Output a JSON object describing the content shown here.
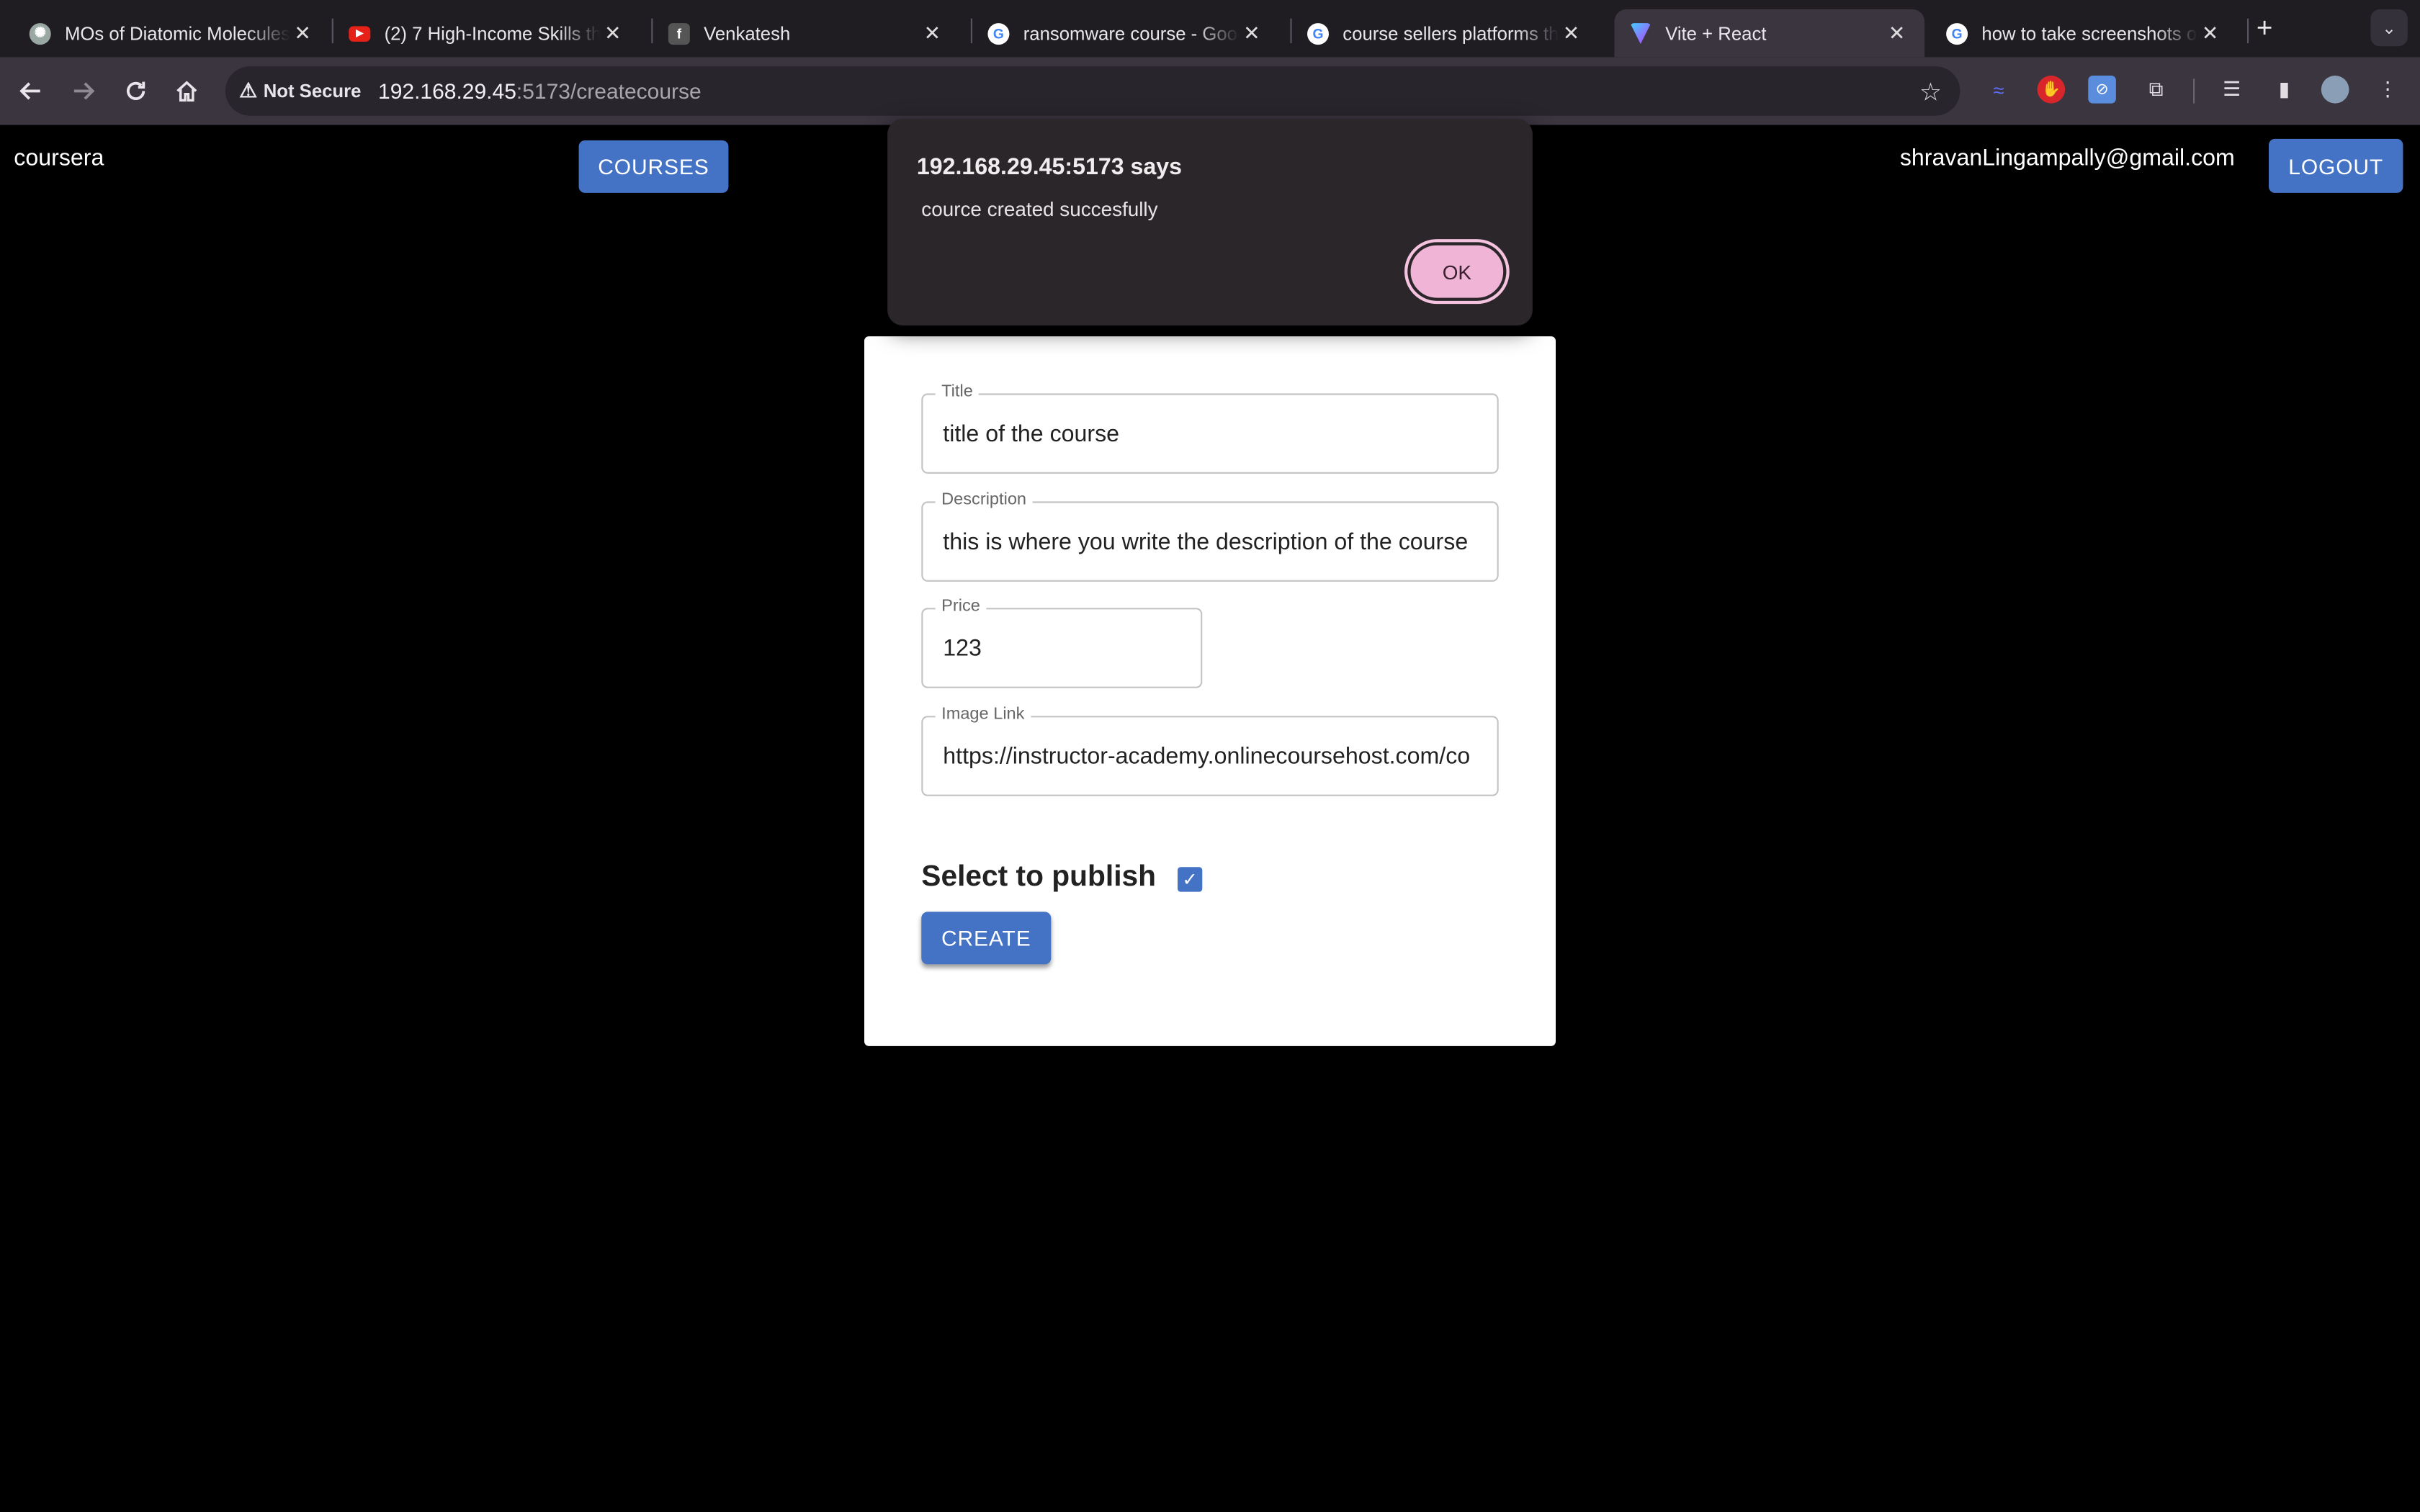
{
  "browser": {
    "tabs": [
      {
        "title": "MOs of Diatomic Molecules",
        "favicon": "chatgpt-icon"
      },
      {
        "title": "(2) 7 High-Income Skills that",
        "favicon": "youtube-icon"
      },
      {
        "title": "Venkatesh",
        "favicon": "page-icon",
        "favicon_text": "f"
      },
      {
        "title": "ransomware course - Google",
        "favicon": "google-icon"
      },
      {
        "title": "course sellers platforms that",
        "favicon": "google-icon"
      },
      {
        "title": "Vite + React",
        "favicon": "vite-icon",
        "active": true
      },
      {
        "title": "how to take screenshots on",
        "favicon": "google-icon"
      }
    ],
    "security_label": "Not Secure",
    "url_host": "192.168.29.45",
    "url_path": ":5173/createcourse"
  },
  "app": {
    "brand": "coursera",
    "courses_label": "COURSES",
    "user_email": "shravanLingampally@gmail.com",
    "logout_label": "LOGOUT"
  },
  "form": {
    "title_label": "Title",
    "title_value": "title of the course",
    "description_label": "Description",
    "description_value": "this is where you write the description of the course",
    "price_label": "Price",
    "price_value": "123",
    "image_label": "Image Link",
    "image_value": "https://instructor-academy.onlinecoursehost.com/co",
    "publish_label": "Select to publish",
    "publish_checked": true,
    "create_label": "CREATE"
  },
  "dialog": {
    "title": "192.168.29.45:5173 says",
    "message": "cource created succesfully",
    "ok_label": "OK"
  },
  "colors": {
    "primary": "#4472c4",
    "dialog_bg": "#2b2629",
    "ok_button": "#f0b4d6"
  }
}
